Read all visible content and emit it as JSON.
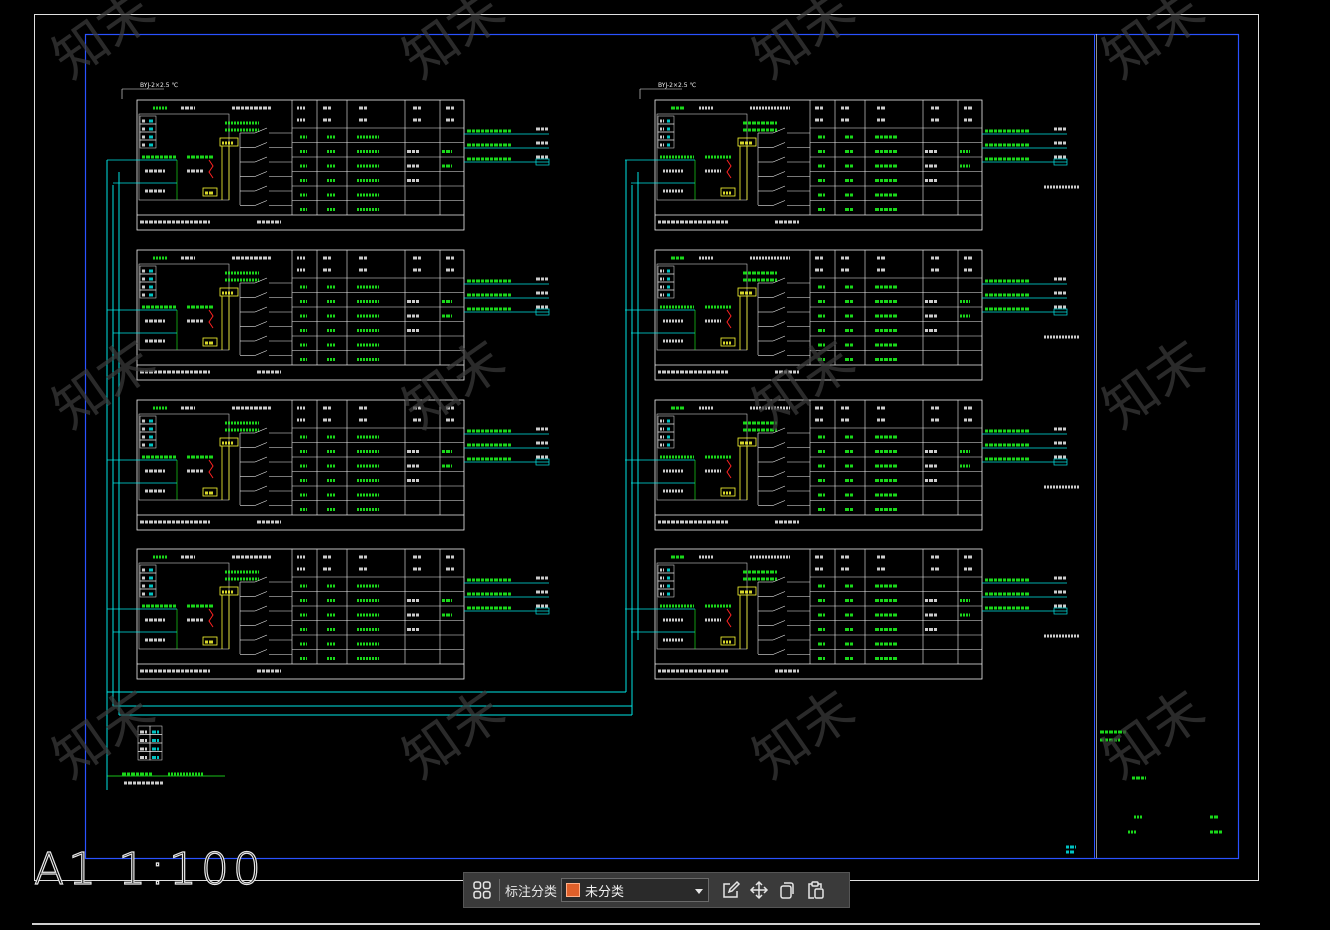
{
  "drawing": {
    "scale_label": "A1  1:100",
    "watermark_text": "知末",
    "busbar_label": "BYJ-2×2.5 ℃",
    "colors": {
      "background": "#000000",
      "frame": "#1f4fff",
      "cyan": "#00e5e5",
      "green": "#1fff1f",
      "white": "#f0f0f0",
      "yellow": "#ffff33",
      "red": "#ff2222"
    }
  },
  "toolbar": {
    "category_label": "标注分类",
    "selected_category": "未分类",
    "swatch_color": "#e0602a",
    "icons": [
      "grid-icon",
      "edit-icon",
      "move-icon",
      "copy-icon",
      "paste-icon"
    ]
  }
}
